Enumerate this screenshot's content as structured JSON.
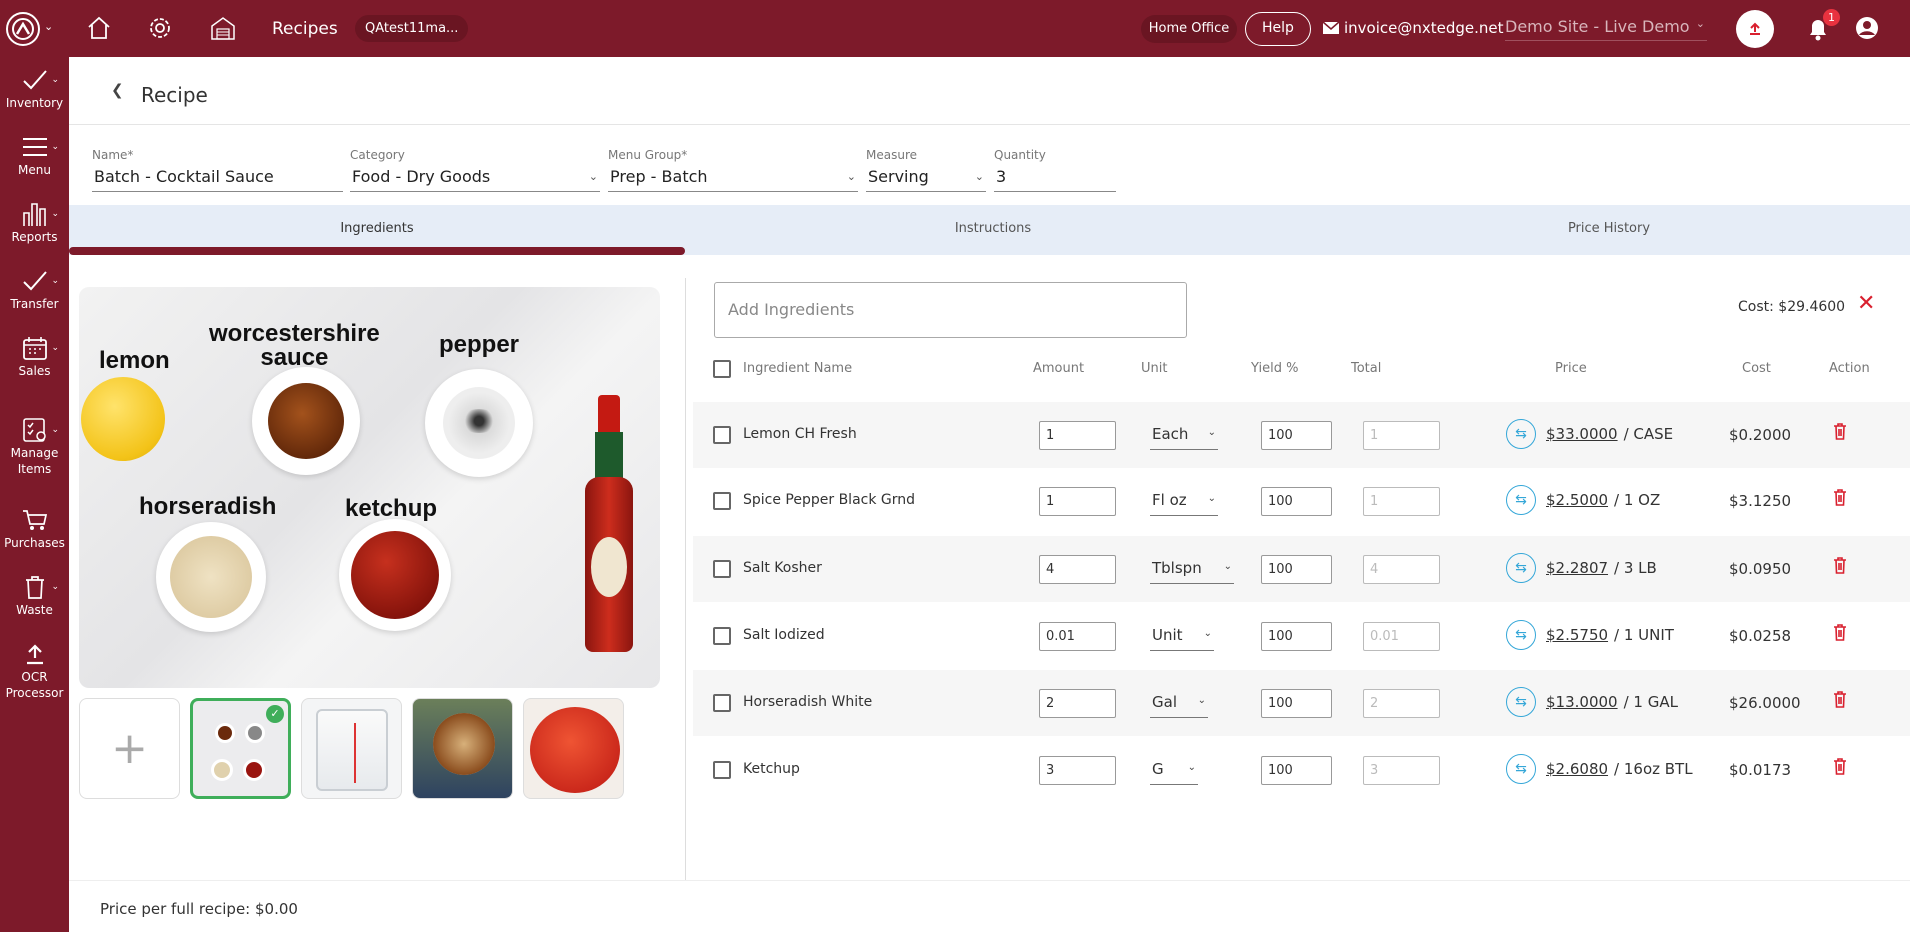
{
  "topbar": {
    "title": "Recipes",
    "pill": "QAtest11ma...",
    "home_office": "Home Office",
    "help": "Help",
    "email": "invoice@nxtedge.net",
    "site": "Demo Site - Live Demo",
    "notification_count": "1"
  },
  "sidebar": {
    "items": [
      {
        "label": "Inventory",
        "icon": "check-icon"
      },
      {
        "label": "Menu",
        "icon": "hamburger-icon"
      },
      {
        "label": "Reports",
        "icon": "bar-chart-icon"
      },
      {
        "label": "Transfer",
        "icon": "check-icon"
      },
      {
        "label": "Sales",
        "icon": "calendar-icon"
      },
      {
        "label": "Manage\nItems",
        "icon": "manage-items-icon"
      },
      {
        "label": "Purchases",
        "icon": "cart-icon"
      },
      {
        "label": "Waste",
        "icon": "trash-icon"
      },
      {
        "label": "OCR\nProcessor",
        "icon": "upload-icon"
      }
    ]
  },
  "header": {
    "title": "Recipe"
  },
  "form": {
    "name_label": "Name*",
    "name_value": "Batch -  Cocktail Sauce",
    "category_label": "Category",
    "category_value": "Food - Dry Goods",
    "menu_group_label": "Menu Group*",
    "menu_group_value": "Prep - Batch",
    "measure_label": "Measure",
    "measure_value": "Serving",
    "quantity_label": "Quantity",
    "quantity_value": "3"
  },
  "tabs": [
    {
      "label": "Ingredients",
      "active": true
    },
    {
      "label": "Instructions",
      "active": false
    },
    {
      "label": "Price History",
      "active": false
    }
  ],
  "image_labels": {
    "lemon": "lemon",
    "worcestershire": "worcestershire\nsauce",
    "pepper": "pepper",
    "horseradish": "horseradish",
    "ketchup": "ketchup"
  },
  "ingredients": {
    "add_placeholder": "Add Ingredients",
    "cost_total": "Cost: $29.4600",
    "columns": {
      "name": "Ingredient Name",
      "amount": "Amount",
      "unit": "Unit",
      "yield": "Yield %",
      "total": "Total",
      "price": "Price",
      "cost": "Cost",
      "action": "Action"
    },
    "rows": [
      {
        "name": "Lemon CH Fresh",
        "amount": "1",
        "unit": "Each",
        "yield": "100",
        "total": "1",
        "price": "$33.0000",
        "per": "/ CASE",
        "cost": "$0.2000"
      },
      {
        "name": "Spice Pepper Black Grnd",
        "amount": "1",
        "unit": "Fl oz",
        "yield": "100",
        "total": "1",
        "price": "$2.5000",
        "per": "/ 1 OZ",
        "cost": "$3.1250"
      },
      {
        "name": "Salt Kosher",
        "amount": "4",
        "unit": "Tblspn",
        "yield": "100",
        "total": "4",
        "price": "$2.2807",
        "per": "/ 3 LB",
        "cost": "$0.0950"
      },
      {
        "name": "Salt Iodized",
        "amount": "0.01",
        "unit": "Unit",
        "yield": "100",
        "total": "0.01",
        "price": "$2.5750",
        "per": "/ 1 UNIT",
        "cost": "$0.0258"
      },
      {
        "name": "Horseradish White",
        "amount": "2",
        "unit": "Gal",
        "yield": "100",
        "total": "2",
        "price": "$13.0000",
        "per": "/ 1 GAL",
        "cost": "$26.0000"
      },
      {
        "name": "Ketchup",
        "amount": "3",
        "unit": "G",
        "yield": "100",
        "total": "3",
        "price": "$2.6080",
        "per": "/ 16oz BTL",
        "cost": "$0.0173"
      }
    ]
  },
  "footer": {
    "price_per_recipe": "Price per full recipe: $0.00"
  },
  "colors": {
    "brand": "#7d1a2a",
    "accent": "#35a7d8",
    "danger": "#d9202f",
    "success": "#3fae5a"
  }
}
